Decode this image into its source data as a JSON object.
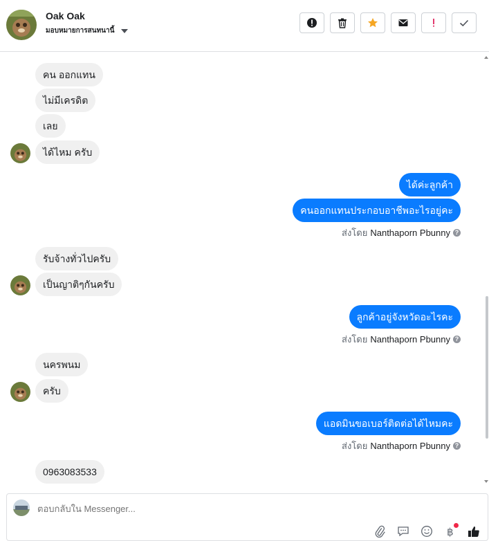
{
  "header": {
    "name": "Oak Oak",
    "subtitle": "มอบหมายการสนทนานี้",
    "actions": [
      {
        "name": "alert-icon"
      },
      {
        "name": "trash-icon"
      },
      {
        "name": "star-icon"
      },
      {
        "name": "envelope-icon"
      },
      {
        "name": "exclamation-icon"
      },
      {
        "name": "check-icon"
      }
    ]
  },
  "colors": {
    "accent": "#0a7cff",
    "incoming_bg": "#f0f0f0",
    "star": "#f5a623",
    "exclamation": "#e0245e"
  },
  "messages": {
    "m1": "คน ออกแทน",
    "m2": "ไม่มีเครดิต",
    "m3": "เลย",
    "m4": "ได้ไหม ครับ",
    "m5": "ได้ค่ะลูกค้า",
    "m6": "คนออกแทนประกอบอาชีพอะไรอยู่คะ",
    "m7": "รับจ้างทั่วไปครับ",
    "m8": "เป็นญาติๆกันครับ",
    "m9": "ลูกค้าอยู่จังหวัดอะไรคะ",
    "m10": "นครพนม",
    "m11": "ครับ",
    "m12": "แอดมินขอเบอร์ติดต่อได้ไหมคะ",
    "m13": "0963083533"
  },
  "sent_by": {
    "prefix": "ส่งโดย",
    "name": "Nanthaporn Pbunny",
    "help": "?"
  },
  "composer": {
    "placeholder": "ตอบกลับใน Messenger...",
    "tools": [
      "paperclip-icon",
      "chat-icon",
      "emoji-icon",
      "baht-icon",
      "thumbs-up-icon"
    ]
  }
}
